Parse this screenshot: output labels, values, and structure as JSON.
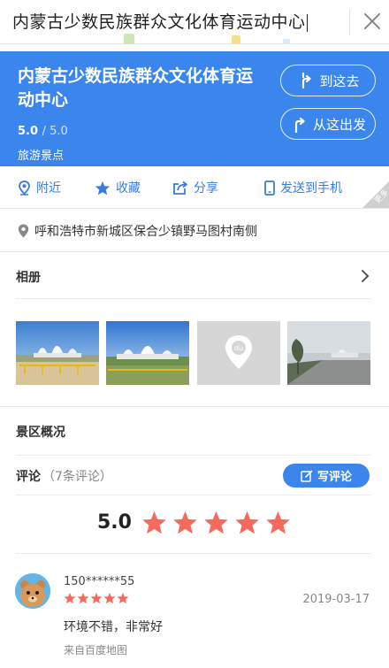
{
  "search": {
    "query": "内蒙古少数民族群众文化体育运动中心"
  },
  "poi": {
    "name": "内蒙古少数民族群众文化体育运动中心",
    "rating": "5.0",
    "rating_max": "/ 5.0",
    "category": "旅游景点",
    "go_here_label": "到这去",
    "depart_from_label": "从这出发"
  },
  "actions": {
    "nearby": "附近",
    "favorite": "收藏",
    "share": "分享",
    "send_to_phone": "发送到手机",
    "more": "更多"
  },
  "address": "呼和浩特市新城区保合少镇野马图村南侧",
  "album": {
    "title": "相册",
    "photo_count": 4
  },
  "overview": {
    "title": "景区概况"
  },
  "reviews": {
    "title": "评论",
    "count_text": "（7条评论）",
    "write_label": "写评论",
    "score": "5.0",
    "stars": 5,
    "items": [
      {
        "user": "150******55",
        "stars": 5,
        "date": "2019-03-17",
        "text": "环境不错，非常好",
        "source": "来自百度地图"
      }
    ]
  },
  "colors": {
    "brand_blue": "#3b86ec",
    "star": "#f46a5c"
  }
}
